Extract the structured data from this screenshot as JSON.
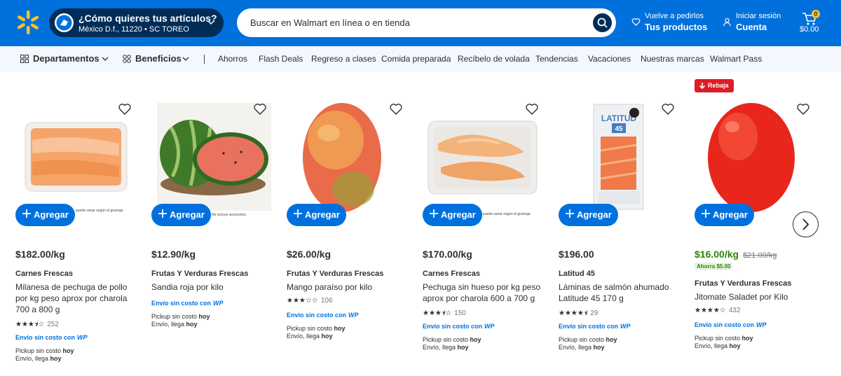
{
  "header": {
    "location_title": "¿Cómo quieres tus artículos?",
    "location_sub": "México D.f., 11220 • SC TOREO",
    "search_placeholder": "Buscar en Walmart en línea o en tienda",
    "reorder_small": "Vuelve a pedirlos",
    "reorder_bold": "Tus productos",
    "account_small": "Iniciar sesión",
    "account_bold": "Cuenta",
    "cart_count": "0",
    "cart_total": "$0.00",
    "brand_color": "#0071dc"
  },
  "nav": {
    "departamentos": "Departamentos",
    "beneficios": "Beneficios",
    "links": [
      "Ahorros",
      "Flash Deals",
      "Regreso a clases",
      "Comida preparada",
      "Recíbelo de volada",
      "Tendencias",
      "Vacaciones",
      "Nuestras marcas",
      "Walmart Pass"
    ]
  },
  "add_label": "Agregar",
  "envio_label": "Envío sin costo con",
  "envio_badge": "WP",
  "pickup_label": "Pickup sin costo",
  "delivery_label": "Envío, llega",
  "today": "hoy",
  "rebaja_label": "Rebaja",
  "fine_print": [
    "puede variar según el gramaje.",
    "No incluye accesorios.",
    "puede variar según el gramaje."
  ],
  "products": [
    {
      "price": "$182.00/kg",
      "brand": "Carnes Frescas",
      "title": "Milanesa de pechuga de pollo por kg peso aprox por charola 700 a 800 g",
      "rating": 3.5,
      "reviews": "252"
    },
    {
      "price": "$12.90/kg",
      "brand": "Frutas Y Verduras Frescas",
      "title": "Sandia roja por kilo",
      "rating": null,
      "reviews": null
    },
    {
      "price": "$26.00/kg",
      "brand": "Frutas Y Verduras Frescas",
      "title": "Mango paraíso por kilo",
      "rating": 3,
      "reviews": "106"
    },
    {
      "price": "$170.00/kg",
      "brand": "Carnes Frescas",
      "title": "Pechuga sin hueso por kg peso aprox por charola 600 a 700 g",
      "rating": 3.5,
      "reviews": "150"
    },
    {
      "price": "$196.00",
      "brand": "Latitud 45",
      "title": "Láminas de salmón ahumado Latitude 45 170 g",
      "rating": 4.5,
      "reviews": "29"
    },
    {
      "price": "$16.00/kg",
      "old_price": "$21.00/kg",
      "ahorro": "Ahorra $5.00",
      "brand": "Frutas Y Verduras Frescas",
      "title": "Jitomate Saladet por Kilo",
      "rating": 4,
      "reviews": "432"
    }
  ]
}
